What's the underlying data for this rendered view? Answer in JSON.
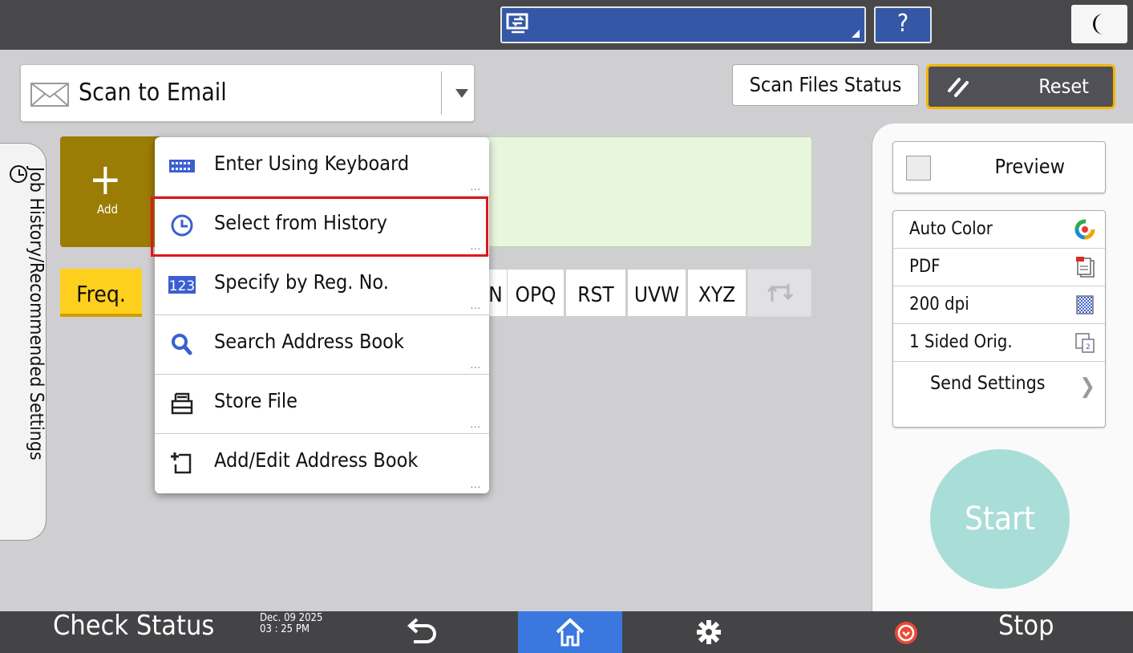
{
  "mode_selector": {
    "title": "Scan to Email",
    "icon": "envelope-icon"
  },
  "header": {
    "scan_files_status": "Scan Files Status",
    "reset": "Reset",
    "help": "?"
  },
  "side_tab": {
    "label": "Job History/Recommended Settings"
  },
  "add_button": {
    "label": "Add"
  },
  "tabs": [
    "Freq.",
    "OPQ",
    "RST",
    "UVW",
    "XYZ"
  ],
  "tab_partial": "N",
  "add_menu": {
    "items": [
      {
        "label": "Enter Using Keyboard",
        "icon": "keyboard-icon"
      },
      {
        "label": "Select from History",
        "icon": "clock-icon"
      },
      {
        "label": "Specify by Reg. No.",
        "icon": "number-123-icon"
      },
      {
        "label": "Search Address Book",
        "icon": "search-icon"
      },
      {
        "label": "Store File",
        "icon": "store-file-icon"
      },
      {
        "label": "Add/Edit Address Book",
        "icon": "add-edit-icon"
      }
    ],
    "more": "..."
  },
  "right_panel": {
    "preview": "Preview",
    "settings": [
      "Auto Color",
      "PDF",
      "200 dpi",
      "1 Sided Orig."
    ],
    "send_settings": "Send Settings",
    "start": "Start"
  },
  "bottom_bar": {
    "check_status": "Check Status",
    "date": "Dec. 09 2025",
    "time": "03 : 25 PM",
    "stop": "Stop"
  },
  "colors": {
    "accent_blue": "#3457a6",
    "add_gold": "#9b7d05",
    "freq_yellow": "#fed01d",
    "highlight_red": "#e0161b",
    "start_mint": "#a8ded7",
    "home_blue": "#3a77df"
  }
}
